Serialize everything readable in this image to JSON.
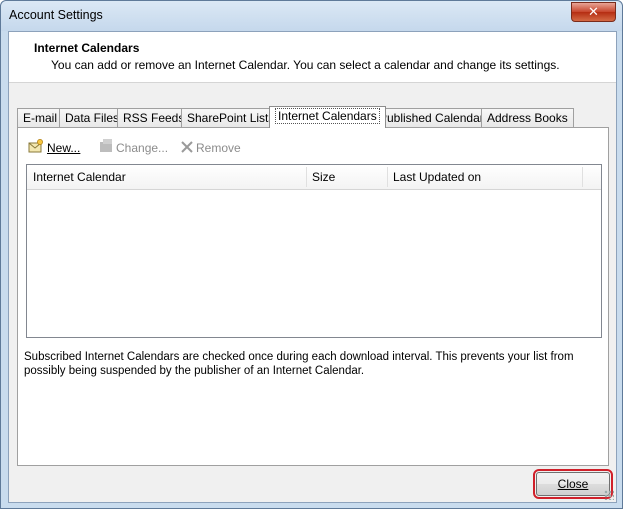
{
  "window": {
    "title": "Account Settings",
    "close_glyph": "✕"
  },
  "header": {
    "title": "Internet Calendars",
    "description": "You can add or remove an Internet Calendar. You can select a calendar and change its settings."
  },
  "tabs": [
    {
      "label": "E-mail",
      "active": false
    },
    {
      "label": "Data Files",
      "active": false
    },
    {
      "label": "RSS Feeds",
      "active": false
    },
    {
      "label": "SharePoint Lists",
      "active": false
    },
    {
      "label": "Internet Calendars",
      "active": true
    },
    {
      "label": "Published Calendars",
      "active": false
    },
    {
      "label": "Address Books",
      "active": false
    }
  ],
  "toolbar": {
    "new_label": "New...",
    "change_label": "Change...",
    "remove_label": "Remove"
  },
  "list": {
    "columns": [
      "Internet Calendar",
      "Size",
      "Last Updated on"
    ],
    "rows": []
  },
  "note": "Subscribed Internet Calendars are checked once during each download interval. This prevents your list from possibly being suspended by the publisher of an Internet Calendar.",
  "footer": {
    "close_label": "Close"
  },
  "colors": {
    "highlight": "#d0202a"
  }
}
